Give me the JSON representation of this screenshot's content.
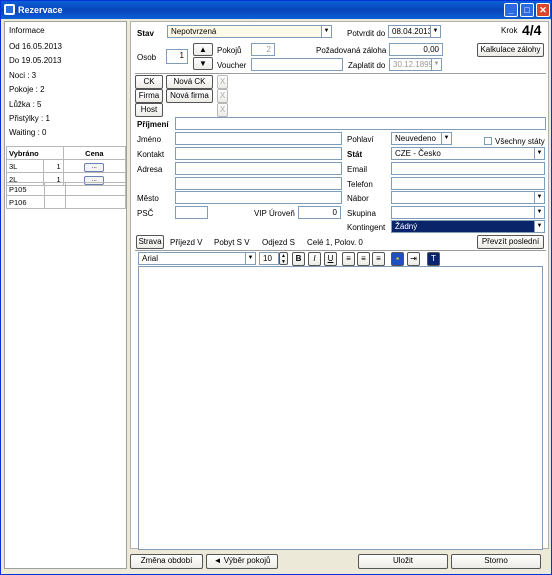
{
  "window": {
    "title": "Rezervace"
  },
  "side": {
    "lines": [
      "Informace",
      "Od 16.05.2013",
      "Do 19.05.2013",
      "Noci : 3",
      "Pokoje : 2",
      "Lůžka : 5",
      "Přistýlky : 1",
      "Waiting : 0"
    ],
    "table": {
      "col1": "Vybráno",
      "col2": "Cena",
      "rows": [
        {
          "name": "3L",
          "count": "1",
          "btn": "..."
        },
        {
          "name": "2L",
          "count": "1",
          "btn": "..."
        }
      ]
    },
    "rooms": [
      "P105",
      "P106"
    ]
  },
  "form": {
    "stav_label": "Stav",
    "stav_value": "Nepotvrzená",
    "potvrdit_label": "Potvrdit do",
    "potvrdit_value": "08.04.2013",
    "krok_label": "Krok",
    "krok_value": "4/4",
    "osob_label": "Osob",
    "osob_value": "1",
    "pokoju_label": "Pokojů",
    "pokoju_value": "2",
    "zaloha_label": "Požadovaná záloha",
    "zaloha_value": "0,00",
    "kalkulace_btn": "Kalkulace zálohy",
    "voucher_label": "Voucher",
    "zaplatit_label": "Zaplatit do",
    "zaplatit_value": "30.12.1899",
    "ck_btn": "CK",
    "nova_ck_btn": "Nová CK",
    "firma_btn": "Firma",
    "nova_firma_btn": "Nová firma",
    "host_btn": "Host",
    "x": "X",
    "prijmeni": "Příjmení",
    "jmeno": "Jméno",
    "kontakt": "Kontakt",
    "adresa": "Adresa",
    "mesto": "Město",
    "psc": "PSČ",
    "vip_label": "VIP Úroveň",
    "vip_value": "0",
    "pohlavi": "Pohlaví",
    "pohlavi_value": "Neuvedeno",
    "vsechny_staty": "Všechny státy",
    "stat": "Stát",
    "stat_value": "CZE - Česko",
    "email": "Email",
    "telefon": "Telefon",
    "nabor": "Nábor",
    "skupina": "Skupina",
    "kontingent": "Kontingent",
    "kontingent_value": "Žádný",
    "strava_btn": "Strava",
    "prijezd": "Příjezd V",
    "pobyt": "Pobyt S V",
    "odjezd": "Odjezd S",
    "cele": "Celé 1, Polov. 0",
    "prevzit_btn": "Převzít poslední",
    "font_value": "Arial",
    "size_value": "10",
    "bold": "B",
    "italic": "I",
    "underline": "U"
  },
  "bottom": {
    "zmena": "Změna období",
    "vyber": "Výběr pokojů",
    "ulozit": "Uložit",
    "storno": "Storno"
  },
  "colors": {
    "titlebar": "#0a5fd8",
    "kontingent_highlight": "#0a246a"
  }
}
